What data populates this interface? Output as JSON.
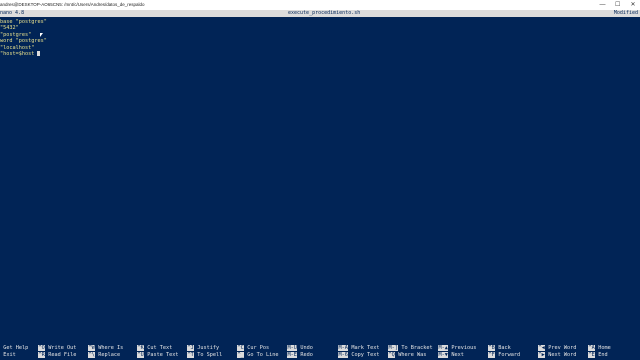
{
  "window": {
    "title": "andres@DESKTOP-AO65CN5: /mnt/c/Users/Andres/datos_de_respaldo",
    "minimize_glyph": "—",
    "maximize_glyph": "☐",
    "close_glyph": "✕"
  },
  "nano": {
    "version": "nano 4.8",
    "filename": "execute_procedimiento.sh",
    "status": "Modified"
  },
  "editor": {
    "lines": [
      "base \"postgres\"",
      "\"5432\"",
      "\"postgres\"",
      "word \"postgres\"",
      "\"localhost\"",
      "\"host=$host"
    ]
  },
  "shortcuts": {
    "row1": [
      {
        "key": "^G",
        "label": "Get Help"
      },
      {
        "key": "^O",
        "label": "Write Out"
      },
      {
        "key": "^W",
        "label": "Where Is"
      },
      {
        "key": "^K",
        "label": "Cut Text"
      },
      {
        "key": "^J",
        "label": "Justify"
      },
      {
        "key": "^C",
        "label": "Cur Pos"
      },
      {
        "key": "M-U",
        "label": "Undo"
      },
      {
        "key": "M-A",
        "label": "Mark Text"
      },
      {
        "key": "M-]",
        "label": "To Bracket"
      },
      {
        "key": "M-▲",
        "label": "Previous"
      },
      {
        "key": "^B",
        "label": "Back"
      },
      {
        "key": "^◀",
        "label": "Prev Word"
      },
      {
        "key": "^A",
        "label": "Home"
      }
    ],
    "row2": [
      {
        "key": "^X",
        "label": "Exit"
      },
      {
        "key": "^R",
        "label": "Read File"
      },
      {
        "key": "^\\",
        "label": "Replace"
      },
      {
        "key": "^U",
        "label": "Paste Text"
      },
      {
        "key": "^T",
        "label": "To Spell"
      },
      {
        "key": "^_",
        "label": "Go To Line"
      },
      {
        "key": "M-E",
        "label": "Redo"
      },
      {
        "key": "M-6",
        "label": "Copy Text"
      },
      {
        "key": "^Q",
        "label": "Where Was"
      },
      {
        "key": "M-▼",
        "label": "Next"
      },
      {
        "key": "^F",
        "label": "Forward"
      },
      {
        "key": "^▶",
        "label": "Next Word"
      },
      {
        "key": "^E",
        "label": "End"
      }
    ]
  },
  "colors": {
    "background": "#012456",
    "text": "#e8e08c",
    "highlight": "#dcdcdc"
  }
}
